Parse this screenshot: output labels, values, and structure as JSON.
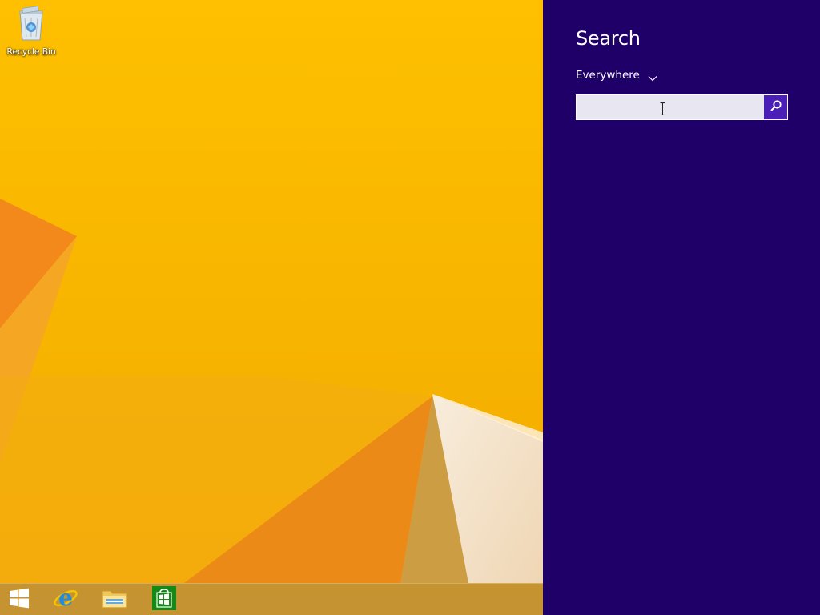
{
  "desktop": {
    "icons": [
      {
        "label": "Recycle Bin",
        "icon": "recycle-bin-icon"
      }
    ],
    "wallpaper_color": "#f7b500"
  },
  "taskbar": {
    "items": [
      {
        "name": "start",
        "icon": "windows-logo-icon"
      },
      {
        "name": "internet-explorer",
        "icon": "internet-explorer-icon"
      },
      {
        "name": "file-explorer",
        "icon": "folder-icon"
      },
      {
        "name": "store",
        "icon": "store-icon"
      }
    ]
  },
  "search_charm": {
    "title": "Search",
    "scope": "Everywhere",
    "input_value": "",
    "search_button_icon": "search-icon",
    "background_color": "#1f0068",
    "accent_color": "#4a1fb8"
  }
}
